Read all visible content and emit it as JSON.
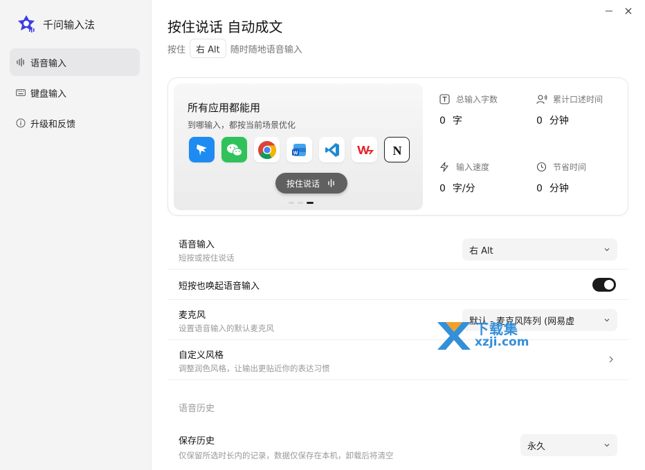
{
  "app": {
    "name": "千问输入法"
  },
  "sidebar": {
    "items": [
      {
        "label": "语音输入",
        "icon": "waveform-icon",
        "active": true
      },
      {
        "label": "键盘输入",
        "icon": "keyboard-icon",
        "active": false
      },
      {
        "label": "升级和反馈",
        "icon": "info-icon",
        "active": false
      }
    ]
  },
  "window": {
    "minimize": "—",
    "close": "✕"
  },
  "header": {
    "title": "按住说话 自动成文",
    "sub_prefix": "按住",
    "hotkey": "右 Alt",
    "sub_suffix": "随时随地语音输入"
  },
  "card": {
    "heading": "所有应用都能用",
    "sub": "到哪输入，都按当前场景优化",
    "apps": [
      "dingtalk-icon",
      "wechat-icon",
      "chrome-icon",
      "word-icon",
      "vscode-icon",
      "wps-icon",
      "notion-icon"
    ],
    "ptt_label": "按住说话",
    "carousel": {
      "count": 3,
      "active": 2
    }
  },
  "stats": [
    {
      "label": "总输入字数",
      "value": "0",
      "unit": "字",
      "icon": "text-icon"
    },
    {
      "label": "累计口述时间",
      "value": "0",
      "unit": "分钟",
      "icon": "speaker-icon"
    },
    {
      "label": "输入速度",
      "value": "0",
      "unit": "字/分",
      "icon": "lightning-icon"
    },
    {
      "label": "节省时间",
      "value": "0",
      "unit": "分钟",
      "icon": "clock-icon"
    }
  ],
  "settings": {
    "voice_input": {
      "title": "语音输入",
      "desc": "短按或按住说话",
      "value": "右 Alt"
    },
    "short_press": {
      "title": "短按也唤起语音输入",
      "enabled": true
    },
    "microphone": {
      "title": "麦克风",
      "desc": "设置语音输入的默认麦克风",
      "value": "默认 - 麦克风阵列 (网易虚"
    },
    "custom_style": {
      "title": "自定义风格",
      "desc": "调整润色风格，让输出更贴近你的表达习惯"
    },
    "history_section": "语音历史",
    "save_history": {
      "title": "保存历史",
      "desc": "仅保留所选时长内的记录，数据仅保存在本机，卸载后将清空",
      "value": "永久"
    }
  },
  "watermark": {
    "cn": "下载集",
    "en": "xzji.com"
  },
  "colors": {
    "accent": "#1a1a1a",
    "brand": "#3d3de6",
    "watermark": "#2a8ad8"
  }
}
